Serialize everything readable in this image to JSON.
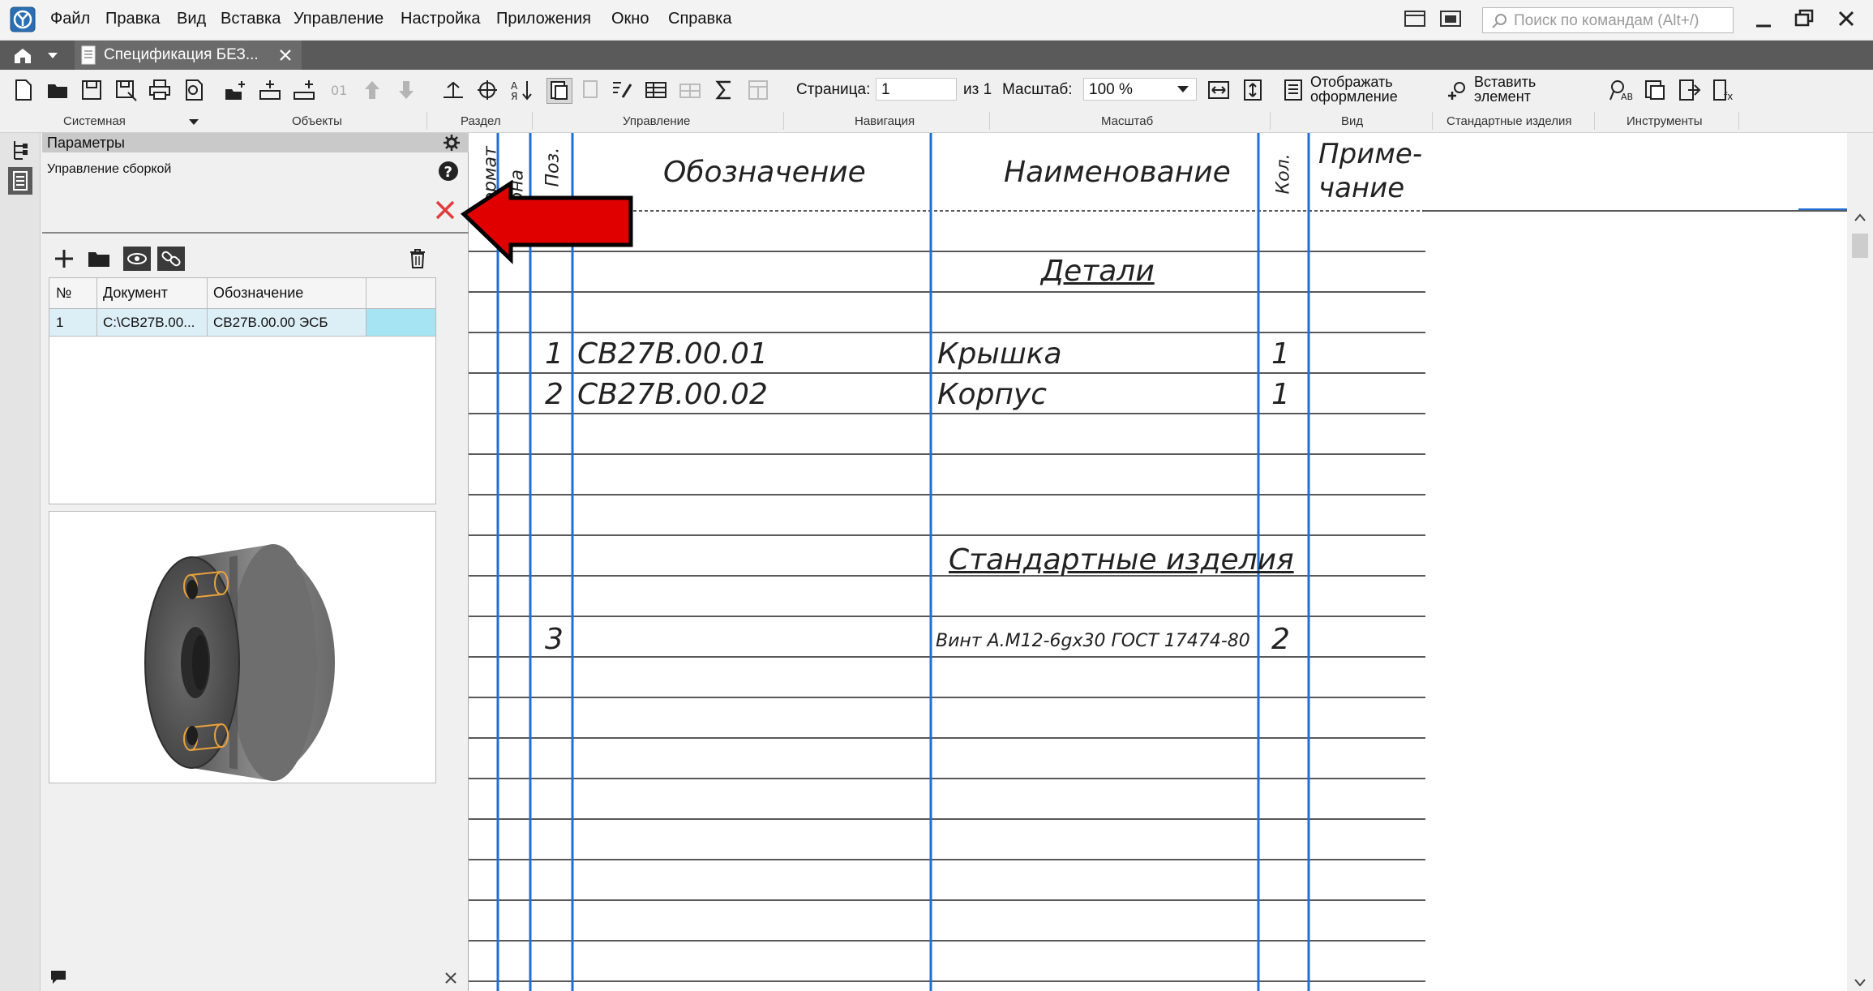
{
  "menubar": {
    "items": [
      "Файл",
      "Правка",
      "Вид",
      "Вставка",
      "Управление",
      "Настройка",
      "Приложения",
      "Окно",
      "Справка"
    ],
    "search_placeholder": "Поиск по командам (Alt+/)"
  },
  "tab": {
    "title": "Спецификация БЕЗ..."
  },
  "toolbar": {
    "page_label": "Страница:",
    "page_value": "1",
    "page_of": "из 1",
    "scale_label": "Масштаб:",
    "scale_value": "100 %",
    "show_design_label": "Отображать оформление",
    "insert_element_label": "Вставить элемент",
    "groups": [
      "Системная",
      "Объекты",
      "Раздел",
      "Управление",
      "Навигация",
      "Масштаб",
      "Вид",
      "Стандартные изделия",
      "Инструменты"
    ]
  },
  "params": {
    "title": "Параметры",
    "subtitle": "Управление сборкой",
    "columns": [
      "№",
      "Документ",
      "Обозначение"
    ],
    "rows": [
      {
        "no": "1",
        "document": "C:\\СВ27В.00...",
        "designation": "СВ27В.00.00 ЭСБ"
      }
    ]
  },
  "spec": {
    "headers": {
      "format": "Формат",
      "zone": "Зона",
      "pos": "Поз.",
      "designation": "Обозначение",
      "name": "Наименование",
      "qty": "Кол.",
      "note_1": "Приме-",
      "note_2": "чание"
    },
    "sections": [
      "Детали",
      "Стандартные изделия"
    ],
    "rows": [
      {
        "pos": "1",
        "designation": "СВ27В.00.01",
        "name": "Крышка",
        "qty": "1"
      },
      {
        "pos": "2",
        "designation": "СВ27В.00.02",
        "name": "Корпус",
        "qty": "1"
      },
      {
        "pos": "3",
        "designation": "",
        "name": "Винт А.М12-6gх30 ГОСТ 17474-80",
        "qty": "2"
      }
    ]
  },
  "colors": {
    "accent_blue": "#1f6fd6",
    "arrow_red": "#e00000",
    "close_red": "#e23b3b",
    "selected_row": "#a6e4f3"
  },
  "icons": [
    "app-logo-icon",
    "search-icon",
    "minimize-icon",
    "maximize-icon",
    "close-icon",
    "home-icon",
    "chevron-down-icon",
    "document-icon",
    "gear-icon",
    "help-icon",
    "plus-icon",
    "folder-icon",
    "eye-icon",
    "link-icon",
    "trash-icon",
    "comment-icon"
  ]
}
